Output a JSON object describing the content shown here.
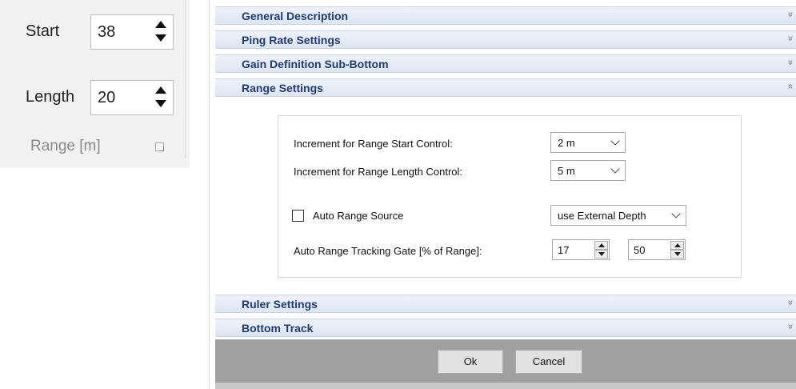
{
  "ribbon": {
    "start": {
      "label": "Start",
      "value": "38"
    },
    "length": {
      "label": "Length",
      "value": "20"
    },
    "group_label": "Range [m]"
  },
  "dialog": {
    "sections_top": [
      {
        "title": "General Description",
        "chevron": "»"
      },
      {
        "title": "Ping Rate Settings",
        "chevron": "»"
      },
      {
        "title": "Gain Definition Sub-Bottom",
        "chevron": "»"
      },
      {
        "title": "Range Settings",
        "chevron": "«",
        "expanded": true
      }
    ],
    "range_settings": {
      "start_increment": {
        "label": "Increment for Range Start Control:",
        "value": "2 m"
      },
      "length_increment": {
        "label": "Increment for Range Length Control:",
        "value": "5 m"
      },
      "auto_range": {
        "label": "Auto Range Source",
        "checked": false,
        "value": "use External Depth"
      },
      "tracking_gate": {
        "label": "Auto Range Tracking Gate [% of Range]:",
        "low": "17",
        "high": "50"
      }
    },
    "sections_bottom": [
      {
        "title": "Ruler Settings",
        "chevron": "»"
      },
      {
        "title": "Bottom Track",
        "chevron": "»"
      }
    ],
    "buttons": {
      "ok": "Ok",
      "cancel": "Cancel"
    }
  }
}
